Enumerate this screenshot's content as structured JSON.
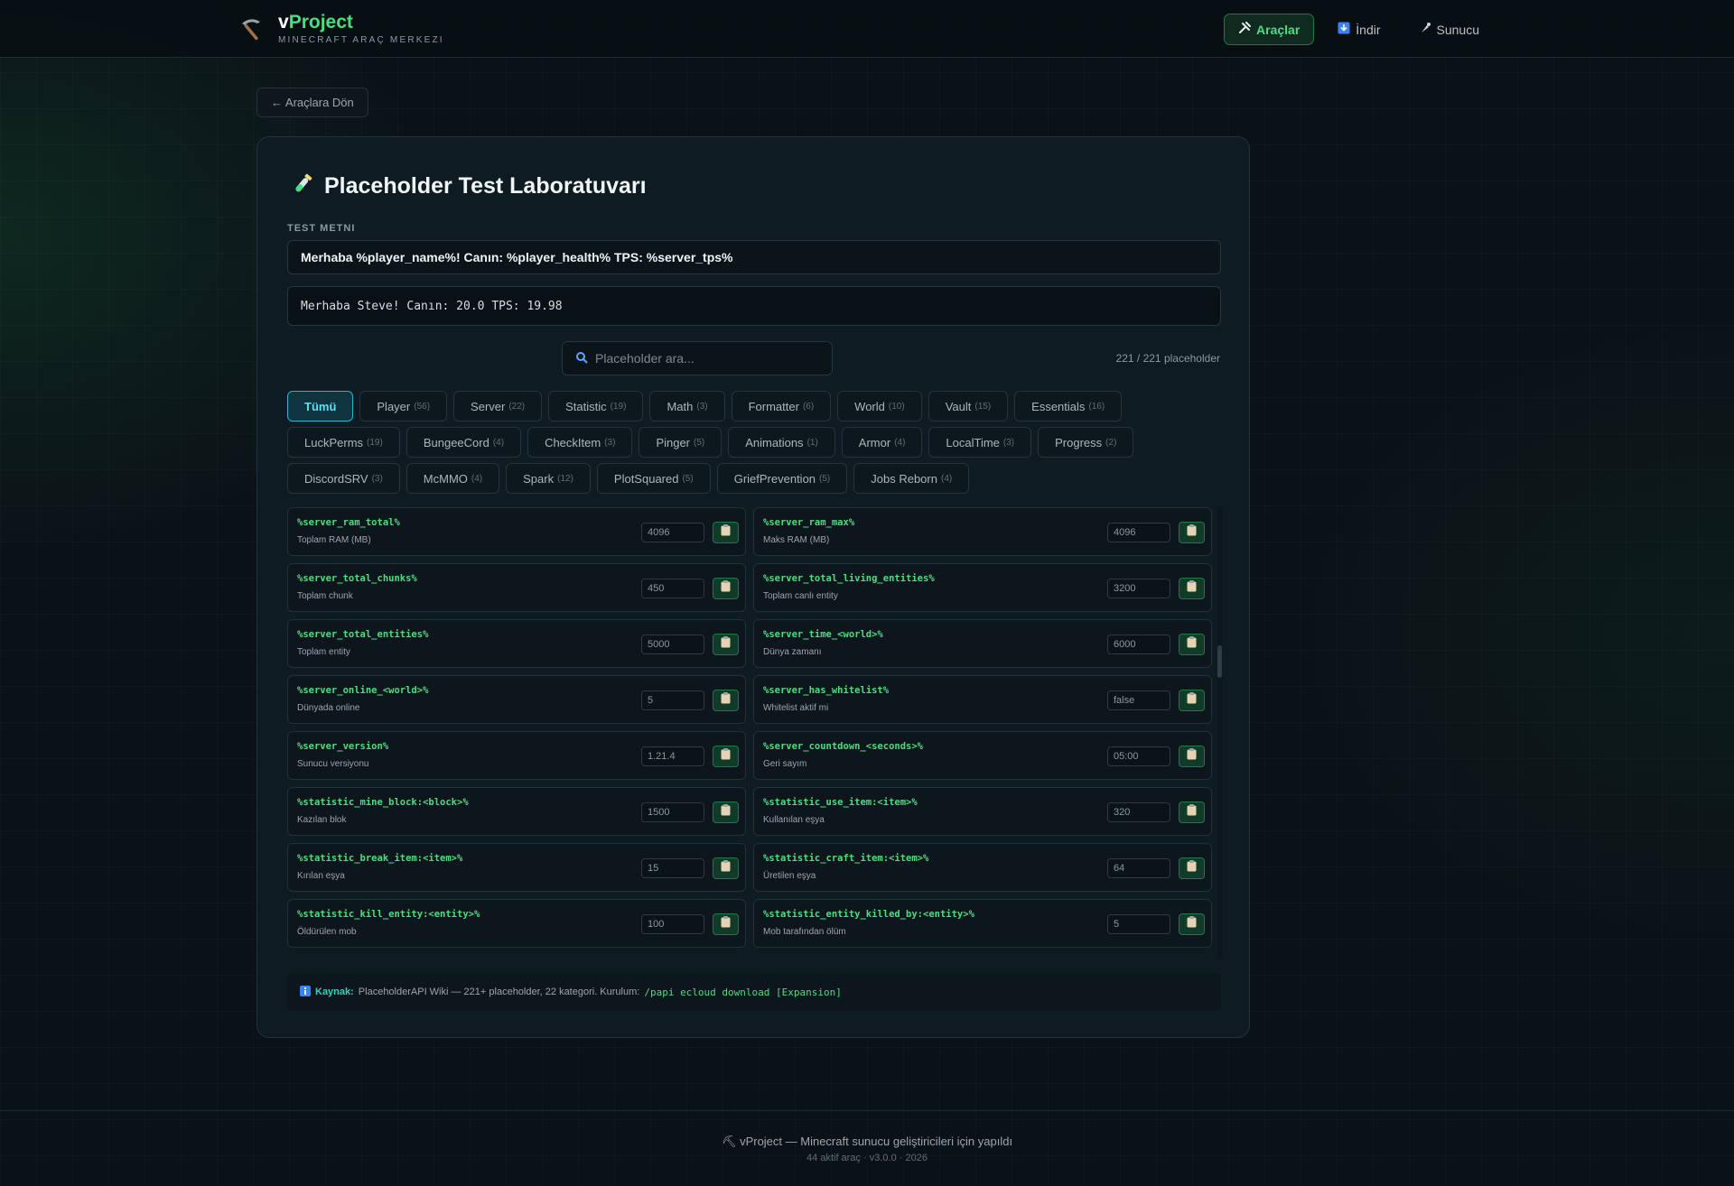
{
  "header": {
    "brand_prefix": "v",
    "brand_accent": "Project",
    "brand_sub": "MINECRAFT ARAÇ MERKEZI",
    "brand_icon": "pickaxe-icon",
    "nav": [
      {
        "label": "Araçlar",
        "icon": "tools-icon",
        "active": true
      },
      {
        "label": "İndir",
        "icon": "download-icon",
        "active": false
      },
      {
        "label": "Sunucu",
        "icon": "server-icon",
        "active": false
      }
    ]
  },
  "back_label": "← Araçlara Dön",
  "card": {
    "title": "Placeholder Test Laboratuvarı",
    "title_icon": "test-tube-icon",
    "test_label": "TEST METNI",
    "test_value": "Merhaba %player_name%! Canın: %player_health% TPS: %server_tps%",
    "output": "Merhaba Steve! Canın: 20.0 TPS: 19.98",
    "search_placeholder": "Placeholder ara...",
    "counter": "221 / 221 placeholder"
  },
  "categories": [
    [
      {
        "label": "Tümü",
        "count": "",
        "active": true
      },
      {
        "label": "Player",
        "count": "(56)"
      },
      {
        "label": "Server",
        "count": "(22)"
      },
      {
        "label": "Statistic",
        "count": "(19)"
      },
      {
        "label": "Math",
        "count": "(3)"
      },
      {
        "label": "Formatter",
        "count": "(6)"
      },
      {
        "label": "World",
        "count": "(10)"
      },
      {
        "label": "Vault",
        "count": "(15)"
      },
      {
        "label": "Essentials",
        "count": "(16)"
      }
    ],
    [
      {
        "label": "LuckPerms",
        "count": "(19)"
      },
      {
        "label": "BungeeCord",
        "count": "(4)"
      },
      {
        "label": "CheckItem",
        "count": "(3)"
      },
      {
        "label": "Pinger",
        "count": "(5)"
      },
      {
        "label": "Animations",
        "count": "(1)"
      },
      {
        "label": "Armor",
        "count": "(4)"
      },
      {
        "label": "LocalTime",
        "count": "(3)"
      },
      {
        "label": "Progress",
        "count": "(2)"
      }
    ],
    [
      {
        "label": "DiscordSRV",
        "count": "(3)"
      },
      {
        "label": "McMMO",
        "count": "(4)"
      },
      {
        "label": "Spark",
        "count": "(12)"
      },
      {
        "label": "PlotSquared",
        "count": "(5)"
      },
      {
        "label": "GriefPrevention",
        "count": "(5)"
      },
      {
        "label": "Jobs Reborn",
        "count": "(4)"
      }
    ]
  ],
  "placeholders": [
    {
      "key": "%server_ram_total%",
      "desc": "Toplam RAM (MB)",
      "value": "4096"
    },
    {
      "key": "%server_ram_max%",
      "desc": "Maks RAM (MB)",
      "value": "4096"
    },
    {
      "key": "%server_total_chunks%",
      "desc": "Toplam chunk",
      "value": "450"
    },
    {
      "key": "%server_total_living_entities%",
      "desc": "Toplam canlı entity",
      "value": "3200"
    },
    {
      "key": "%server_total_entities%",
      "desc": "Toplam entity",
      "value": "5000"
    },
    {
      "key": "%server_time_<world>%",
      "desc": "Dünya zamanı",
      "value": "6000"
    },
    {
      "key": "%server_online_<world>%",
      "desc": "Dünyada online",
      "value": "5"
    },
    {
      "key": "%server_has_whitelist%",
      "desc": "Whitelist aktif mi",
      "value": "false"
    },
    {
      "key": "%server_version%",
      "desc": "Sunucu versiyonu",
      "value": "1.21.4"
    },
    {
      "key": "%server_countdown_<seconds>%",
      "desc": "Geri sayım",
      "value": "05:00"
    },
    {
      "key": "%statistic_mine_block:<block>%",
      "desc": "Kazılan blok",
      "value": "1500"
    },
    {
      "key": "%statistic_use_item:<item>%",
      "desc": "Kullanılan eşya",
      "value": "320"
    },
    {
      "key": "%statistic_break_item:<item>%",
      "desc": "Kırılan eşya",
      "value": "15"
    },
    {
      "key": "%statistic_craft_item:<item>%",
      "desc": "Üretilen eşya",
      "value": "64"
    },
    {
      "key": "%statistic_kill_entity:<entity>%",
      "desc": "Öldürülen mob",
      "value": "100"
    },
    {
      "key": "%statistic_entity_killed_by:<entity>%",
      "desc": "Mob tarafından ölüm",
      "value": "5"
    }
  ],
  "info": {
    "label": "Kaynak:",
    "text": "PlaceholderAPI Wiki — 221+ placeholder, 22 kategori. Kurulum:",
    "command": "/papi ecloud download [Expansion]"
  },
  "footer": {
    "line1": "vProject — Minecraft sunucu geliştiricileri için yapıldı",
    "line2": "44 aktif araç · v3.0.0 · 2026"
  },
  "colors": {
    "accent_green": "#4ade80",
    "accent_cyan": "#5ee0f0",
    "background": "#0b1217"
  }
}
